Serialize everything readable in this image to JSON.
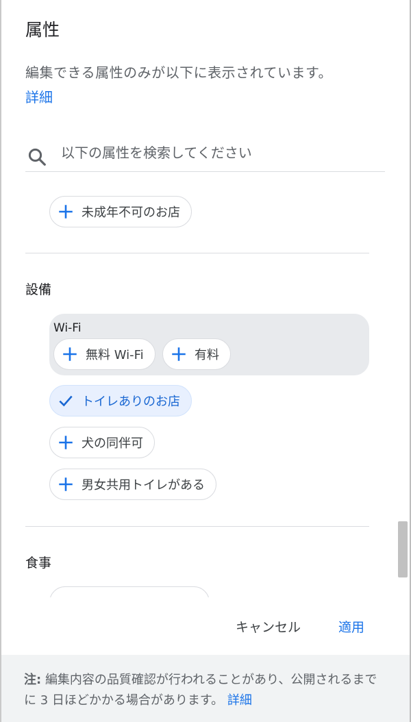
{
  "header": {
    "title": "属性",
    "description": "編集できる属性のみが以下に表示されています。",
    "details_link": "詳細"
  },
  "search": {
    "placeholder": "以下の属性を検索してください",
    "value": ""
  },
  "top_chips": [
    {
      "label": "未成年不可のお店",
      "selected": false
    }
  ],
  "facilities": {
    "title": "設備",
    "wifi_group": {
      "label": "Wi-Fi",
      "options": [
        {
          "label": "無料 Wi-Fi",
          "selected": false
        },
        {
          "label": "有料",
          "selected": false
        }
      ]
    },
    "chips": [
      {
        "label": "トイレありのお店",
        "selected": true
      },
      {
        "label": "犬の同伴可",
        "selected": false
      },
      {
        "label": "男女共用トイレがある",
        "selected": false
      }
    ]
  },
  "meals": {
    "title": "食事"
  },
  "actions": {
    "cancel_label": "キャンセル",
    "apply_label": "適用"
  },
  "footer": {
    "note_label": "注:",
    "note_text": "編集内容の品質確認が行われることがあり、公開されるまでに 3 日ほどかかる場合があります。",
    "details_link": "詳細"
  },
  "colors": {
    "accent": "#1a73e8",
    "selected_chip_bg": "#e8f0fe",
    "group_bg": "#e8eaed",
    "footer_bg": "#f1f3f4"
  },
  "icons": {
    "search": "search-icon",
    "add": "plus-icon",
    "selected": "check-icon"
  }
}
